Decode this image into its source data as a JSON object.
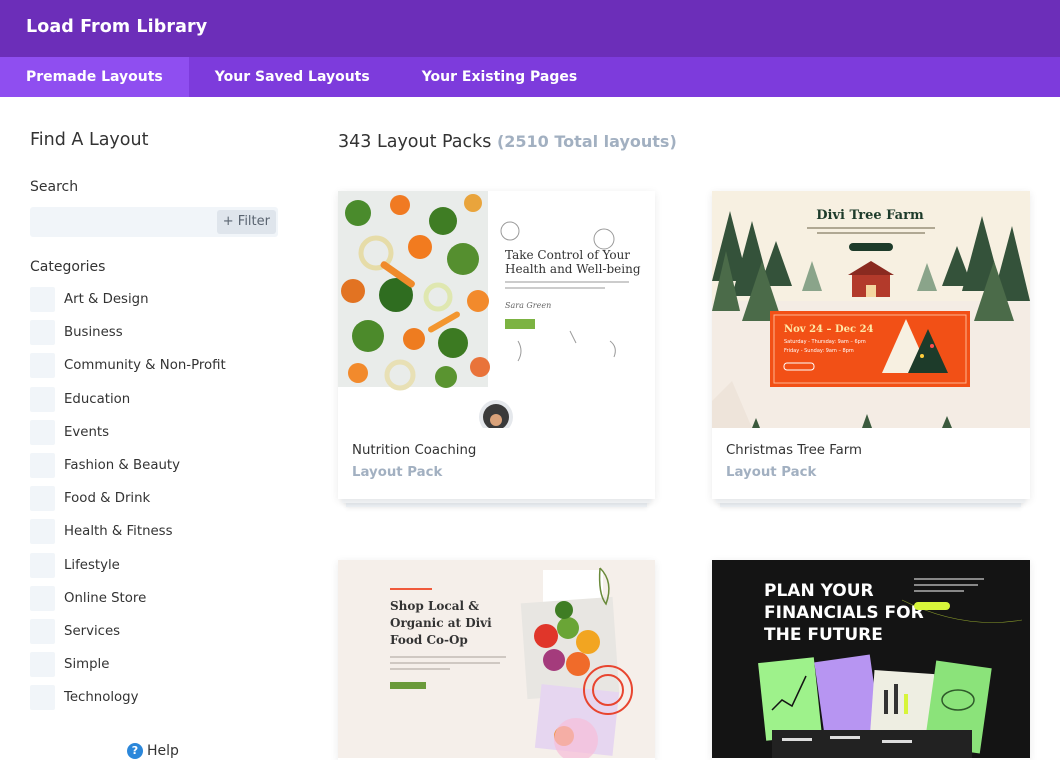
{
  "window": {
    "title": "Load From Library"
  },
  "tabs": [
    {
      "label": "Premade Layouts",
      "active": true
    },
    {
      "label": "Your Saved Layouts",
      "active": false
    },
    {
      "label": "Your Existing Pages",
      "active": false
    }
  ],
  "sidebar": {
    "title": "Find A Layout",
    "search_label": "Search",
    "search_value": "",
    "filter_label": "+ Filter",
    "categories_label": "Categories",
    "categories": [
      "Art & Design",
      "Business",
      "Community & Non-Profit",
      "Education",
      "Events",
      "Fashion & Beauty",
      "Food & Drink",
      "Health & Fitness",
      "Lifestyle",
      "Online Store",
      "Services",
      "Simple",
      "Technology"
    ],
    "help_label": "Help"
  },
  "main": {
    "count_text": "343 Layout Packs",
    "total_text": "(2510 Total layouts)",
    "cards": [
      {
        "name": "Nutrition Coaching",
        "kind": "Layout Pack",
        "preview": {
          "headline_1": "Take Control of Your",
          "headline_2": "Health and Well-being",
          "signature": "Sara Green"
        }
      },
      {
        "name": "Christmas Tree Farm",
        "kind": "Layout Pack",
        "preview": {
          "title": "Divi Tree Farm",
          "dates": "Nov 24 – Dec 24",
          "hours_1": "Saturday - Thursday: 9am – 6pm",
          "hours_2": "Friday - Sunday: 9am – 8pm"
        }
      },
      {
        "preview": {
          "headline_1": "Shop Local &",
          "headline_2": "Organic at Divi",
          "headline_3": "Food Co-Op"
        }
      },
      {
        "preview": {
          "headline_1": "PLAN YOUR",
          "headline_2": "FINANCIALS FOR",
          "headline_3": "THE FUTURE"
        }
      }
    ]
  },
  "colors": {
    "header": "#6c2eb9",
    "tabbar": "#7d3bdc",
    "active_tab": "#8f4ef0",
    "muted": "#a2b0c1"
  }
}
